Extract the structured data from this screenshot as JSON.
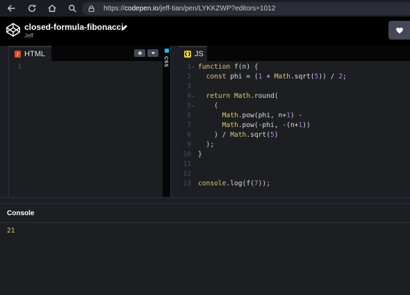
{
  "browser": {
    "url_scheme": "https://",
    "url_domain": "codepen.io",
    "url_path": "/jeff-tian/pen/LYKKZWP?editors=1012"
  },
  "pen": {
    "title": "closed-formula-fibonacci",
    "author": "Jeff"
  },
  "editors": {
    "html": {
      "label": "HTML",
      "lines": [
        "1"
      ]
    },
    "css": {
      "label": "CSS"
    },
    "js": {
      "label": "JS",
      "lines": [
        {
          "n": "1",
          "fold": "▾",
          "text": "function f(n) {"
        },
        {
          "n": "2",
          "fold": "",
          "text": "  const phi = (1 + Math.sqrt(5)) / 2;"
        },
        {
          "n": "3",
          "fold": "",
          "text": ""
        },
        {
          "n": "4",
          "fold": "▾",
          "text": "  return Math.round("
        },
        {
          "n": "5",
          "fold": "▾",
          "text": "    ("
        },
        {
          "n": "6",
          "fold": "",
          "text": "      Math.pow(phi, n+1) -"
        },
        {
          "n": "7",
          "fold": "",
          "text": "      Math.pow(-phi, -(n+1))"
        },
        {
          "n": "8",
          "fold": "",
          "text": "    ) / Math.sqrt(5)"
        },
        {
          "n": "9",
          "fold": "",
          "text": "  );"
        },
        {
          "n": "10",
          "fold": "",
          "text": "}"
        },
        {
          "n": "11",
          "fold": "",
          "text": ""
        },
        {
          "n": "12",
          "fold": "",
          "text": ""
        },
        {
          "n": "13",
          "fold": "",
          "text": "console.log(f(7));"
        }
      ]
    }
  },
  "console": {
    "title": "Console",
    "output": "21"
  },
  "icons": {
    "back": "arrow-left-icon",
    "reload": "reload-icon",
    "home": "home-icon",
    "search": "search-icon",
    "site_info": "lock-icon",
    "logo": "codepen-logo-icon",
    "edit": "pencil-icon",
    "heart": "heart-icon",
    "settings": "gear-icon",
    "collapse": "chevron-down-icon"
  },
  "colors": {
    "html_badge": "#e44d26",
    "js_badge": "#f1d73e",
    "css_badge": "#0ebeff",
    "console_output": "#ddca7e"
  }
}
